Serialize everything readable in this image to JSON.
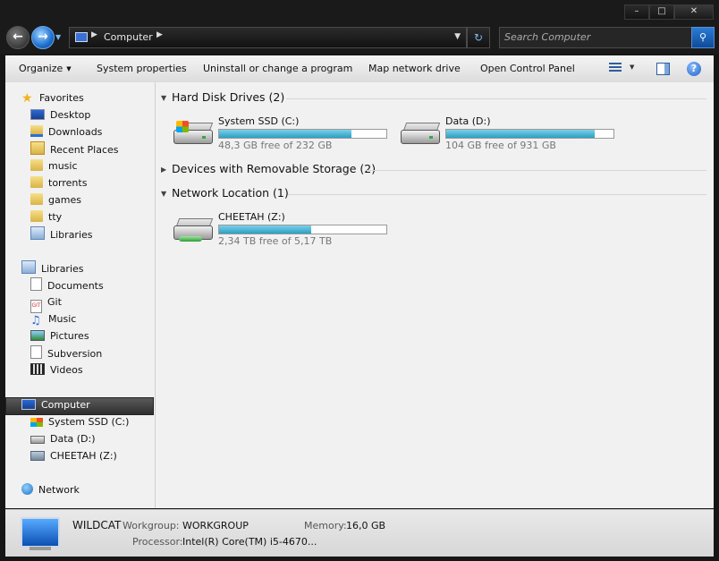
{
  "address": {
    "crumb": "Computer"
  },
  "search": {
    "placeholder": "Search Computer"
  },
  "toolbar": {
    "organize": "Organize",
    "system_properties": "System properties",
    "uninstall": "Uninstall or change a program",
    "map_drive": "Map network drive",
    "control_panel": "Open Control Panel"
  },
  "nav": {
    "favorites": "Favorites",
    "fav_items": [
      "Desktop",
      "Downloads",
      "Recent Places",
      "music",
      "torrents",
      "games",
      "tty",
      "Libraries"
    ],
    "libraries": "Libraries",
    "lib_items": [
      "Documents",
      "Git",
      "Music",
      "Pictures",
      "Subversion",
      "Videos"
    ],
    "computer": "Computer",
    "comp_items": [
      "System SSD (C:)",
      "Data (D:)",
      "CHEETAH (Z:)"
    ],
    "network": "Network"
  },
  "groups": {
    "hdd": "Hard Disk Drives (2)",
    "removable": "Devices with Removable Storage (2)",
    "network": "Network Location (1)"
  },
  "drives": [
    {
      "name": "System SSD (C:)",
      "free": "48,3 GB free of 232 GB",
      "used_fraction": 0.79
    },
    {
      "name": "Data (D:)",
      "free": "104 GB free of 931 GB",
      "used_fraction": 0.89
    },
    {
      "name": "CHEETAH (Z:)",
      "free": "2,34 TB free of 5,17 TB",
      "used_fraction": 0.55
    }
  ],
  "details": {
    "hostname": "WILDCAT",
    "workgroup_label": "Workgroup:",
    "workgroup": "WORKGROUP",
    "memory_label": "Memory:",
    "memory": "16,0 GB",
    "processor_label": "Processor:",
    "processor": "Intel(R) Core(TM) i5-4670..."
  }
}
